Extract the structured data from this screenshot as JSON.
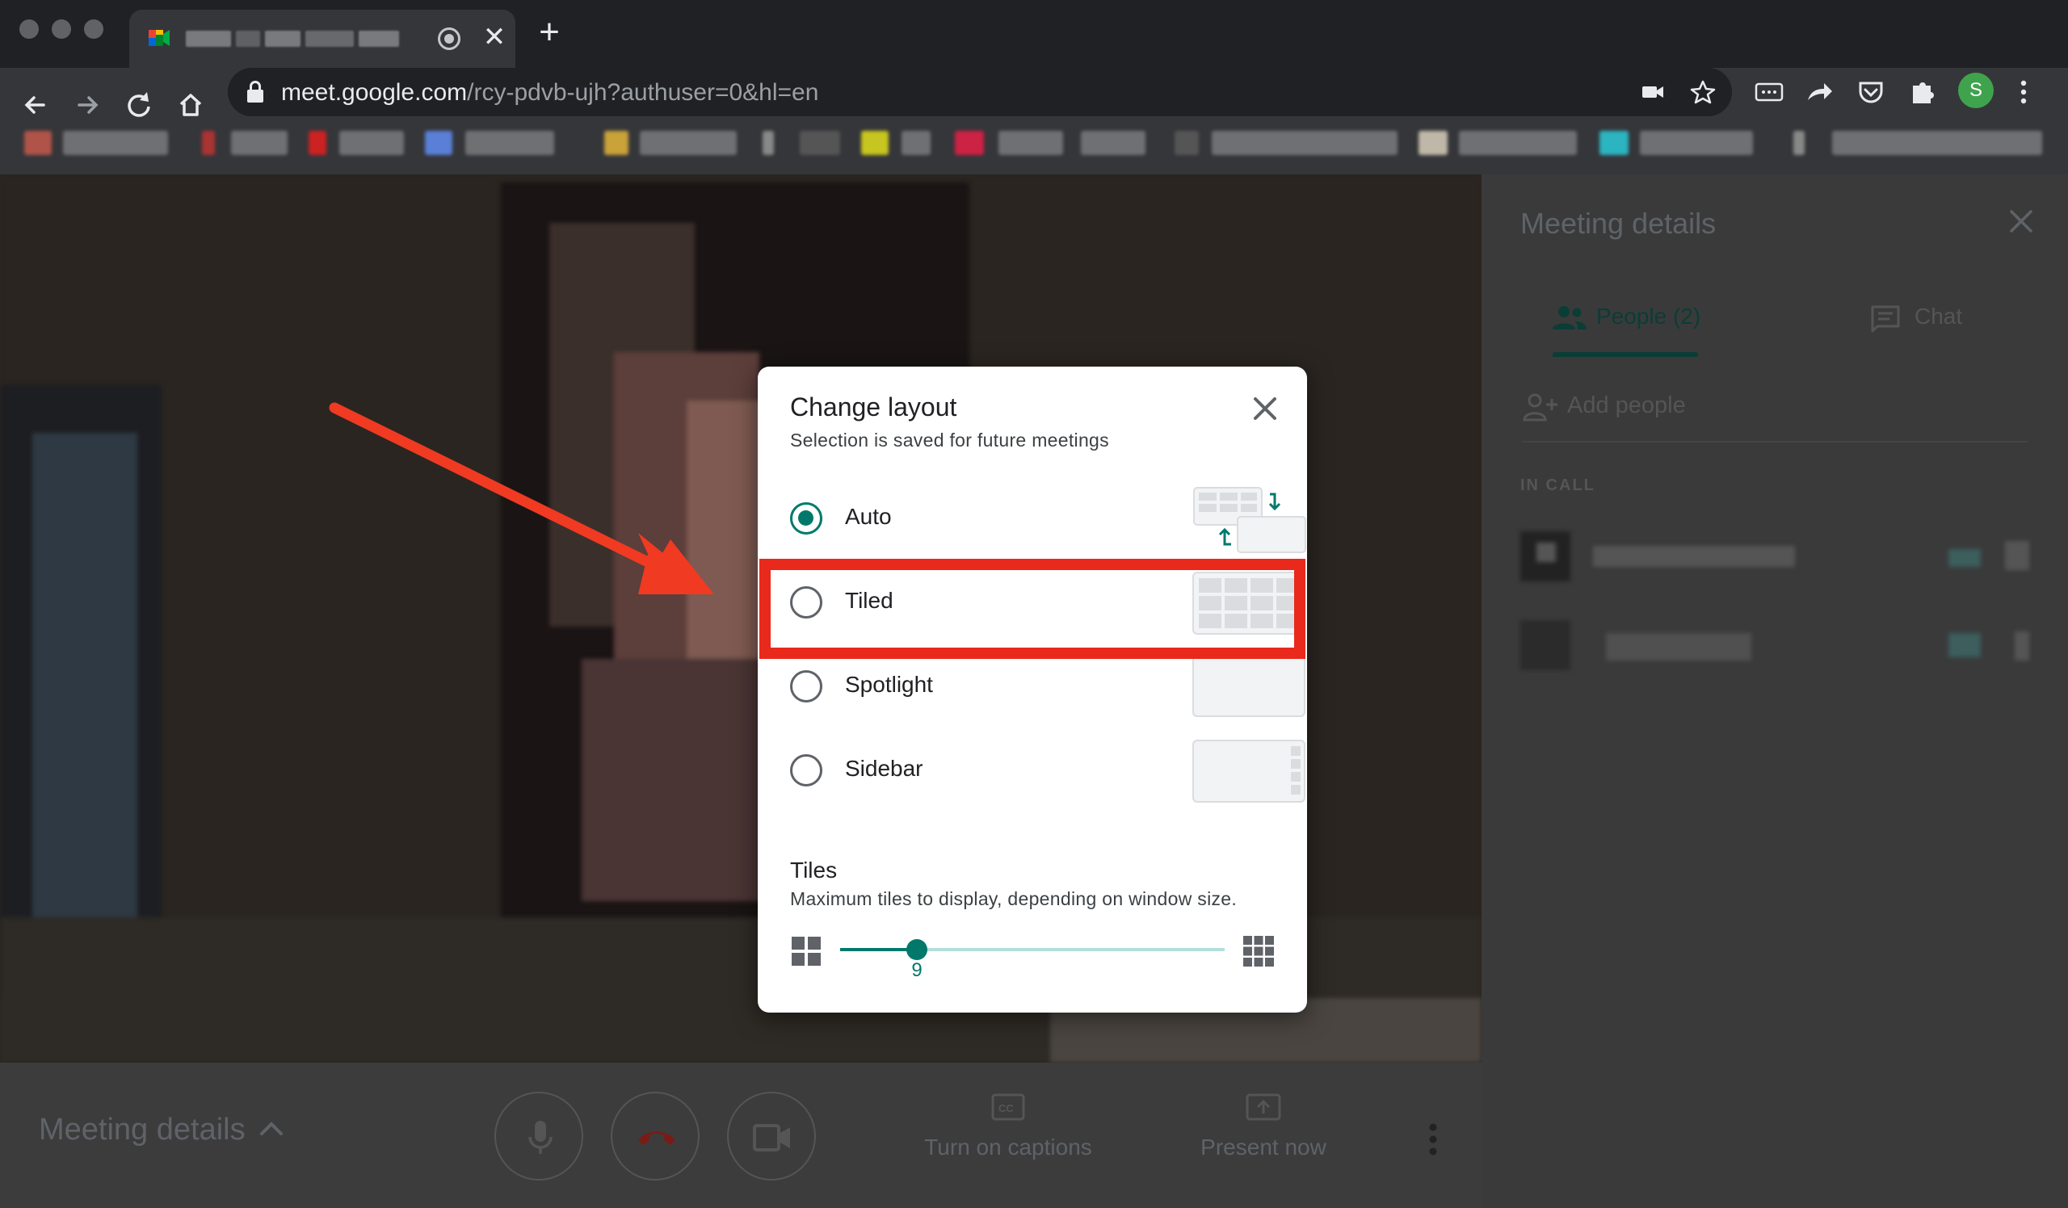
{
  "browser": {
    "tab": {
      "title_redacted": true,
      "close_glyph": "✕"
    },
    "new_tab_glyph": "+",
    "url_host": "meet.google.com",
    "url_path": "/rcy-pdvb-ujh?authuser=0&hl=en",
    "profile_initial": "S",
    "icons": [
      "back-icon",
      "forward-icon",
      "reload-icon",
      "home-icon",
      "lock-icon",
      "camera-icon",
      "star-icon",
      "more-ext-icon",
      "share-icon",
      "pocket-icon",
      "puzzle-icon",
      "menu-icon"
    ]
  },
  "dialog": {
    "title": "Change layout",
    "subtitle": "Selection is saved for future meetings",
    "options": [
      {
        "label": "Auto",
        "checked": true
      },
      {
        "label": "Tiled",
        "checked": false
      },
      {
        "label": "Spotlight",
        "checked": false
      },
      {
        "label": "Sidebar",
        "checked": false
      }
    ],
    "tiles_title": "Tiles",
    "tiles_subtitle": "Maximum tiles to display, depending on window size.",
    "slider": {
      "value": "9",
      "fraction": 0.2
    }
  },
  "panel": {
    "title": "Meeting details",
    "tabs": [
      {
        "label": "People (2)",
        "active": true
      },
      {
        "label": "Chat",
        "active": false
      }
    ],
    "add_people": "Add people",
    "in_call": "IN CALL"
  },
  "bottombar": {
    "meeting_details": "Meeting details",
    "captions": "Turn on captions",
    "present": "Present now"
  },
  "colors": {
    "accent": "#00796b",
    "highlight": "#e8291c",
    "arrow": "#f03a22"
  }
}
